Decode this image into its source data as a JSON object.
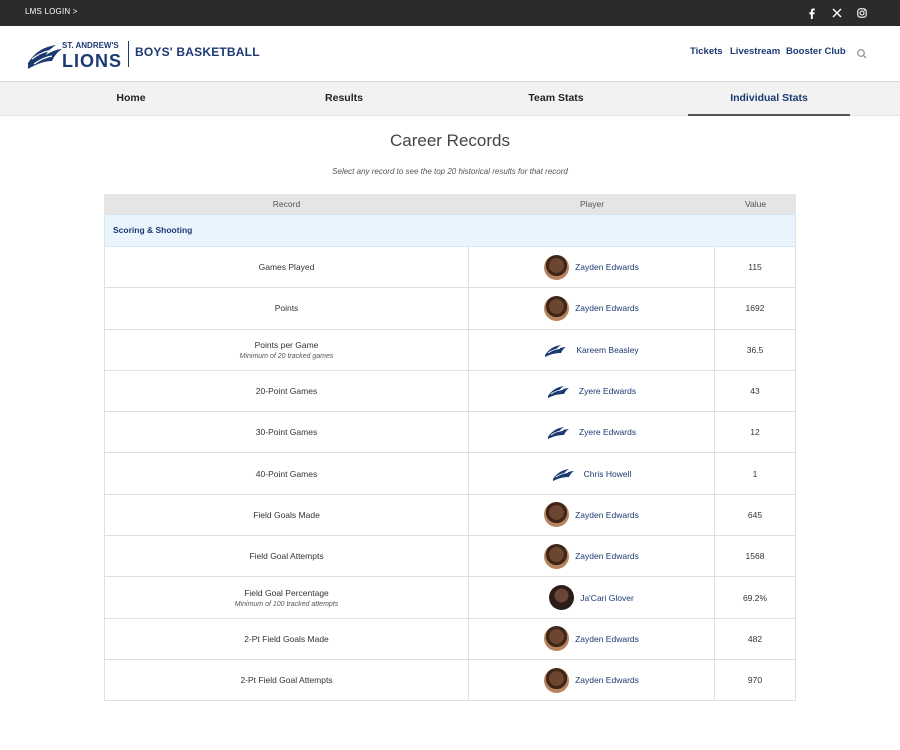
{
  "topbar": {
    "lms_label": "LMS LOGIN >"
  },
  "header": {
    "logo_line1": "ST. ANDREW'S",
    "logo_line2": "LIONS",
    "team_name": "BOYS' BASKETBALL",
    "nav": [
      "Tickets",
      "Livestream",
      "Booster Club"
    ]
  },
  "tabs": [
    "Home",
    "Results",
    "Team Stats",
    "Individual Stats"
  ],
  "page": {
    "title": "Career Records",
    "subtitle": "Select any record to see the top 20 historical results for that record"
  },
  "table": {
    "headers": [
      "Record",
      "Player",
      "Value"
    ],
    "section": "Scoring & Shooting",
    "rows": [
      {
        "record": "Games Played",
        "note": "",
        "player": "Zayden Edwards",
        "avatar": "photo",
        "value": "115"
      },
      {
        "record": "Points",
        "note": "",
        "player": "Zayden Edwards",
        "avatar": "photo",
        "value": "1692"
      },
      {
        "record": "Points per Game",
        "note": "Minimum of 20 tracked games",
        "player": "Kareem Beasley",
        "avatar": "logo",
        "value": "36.5"
      },
      {
        "record": "20-Point Games",
        "note": "",
        "player": "Zyere Edwards",
        "avatar": "logo",
        "value": "43"
      },
      {
        "record": "30-Point Games",
        "note": "",
        "player": "Zyere Edwards",
        "avatar": "logo",
        "value": "12"
      },
      {
        "record": "40-Point Games",
        "note": "",
        "player": "Chris Howell",
        "avatar": "logo",
        "value": "1"
      },
      {
        "record": "Field Goals Made",
        "note": "",
        "player": "Zayden Edwards",
        "avatar": "photo",
        "value": "645"
      },
      {
        "record": "Field Goal Attempts",
        "note": "",
        "player": "Zayden Edwards",
        "avatar": "photo",
        "value": "1568"
      },
      {
        "record": "Field Goal Percentage",
        "note": "Minimum of 100 tracked attempts",
        "player": "Ja'Cari Glover",
        "avatar": "photo-dark",
        "value": "69.2%"
      },
      {
        "record": "2-Pt Field Goals Made",
        "note": "",
        "player": "Zayden Edwards",
        "avatar": "photo",
        "value": "482"
      },
      {
        "record": "2-Pt Field Goal Attempts",
        "note": "",
        "player": "Zayden Edwards",
        "avatar": "photo",
        "value": "970"
      }
    ]
  },
  "colors": {
    "brand_navy": "#1c3a72",
    "topbar": "#2b2b2b",
    "section_bg": "#eaf4fc"
  },
  "icons": [
    "facebook-icon",
    "x-icon",
    "instagram-icon",
    "search-icon",
    "lion-logo-icon"
  ]
}
